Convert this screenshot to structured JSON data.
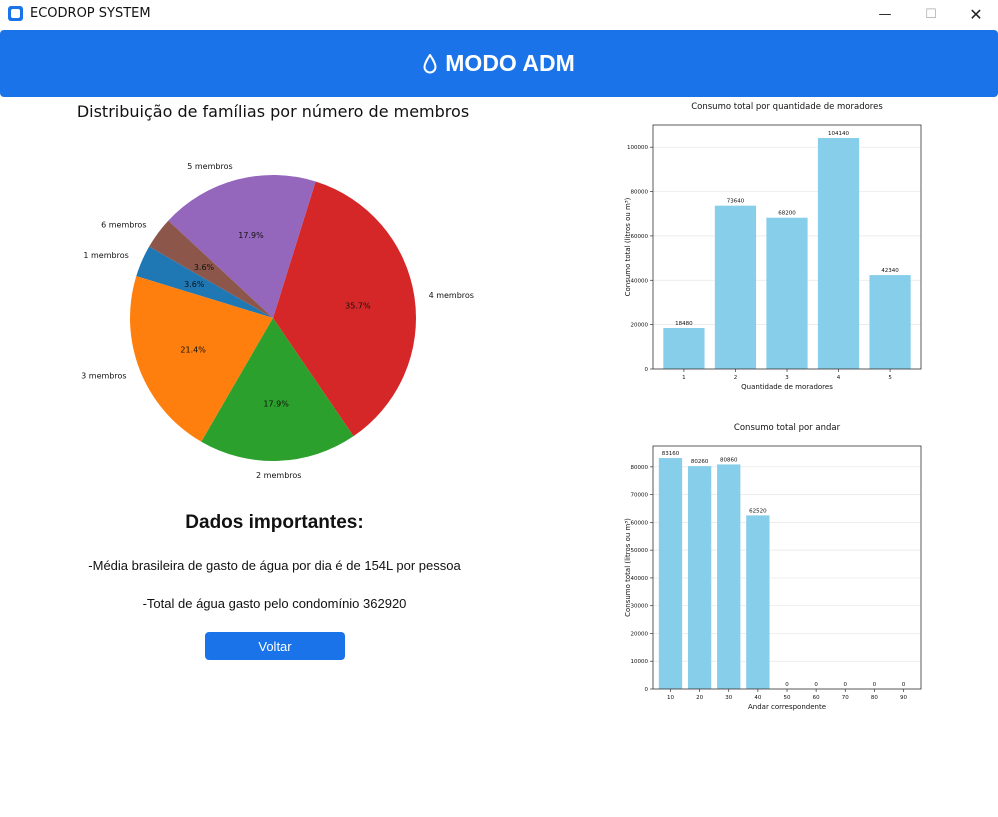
{
  "window": {
    "title": "ECODROP SYSTEM",
    "minimize": "—",
    "maximize": "☐",
    "close": "✕"
  },
  "header": {
    "title": "MODO ADM",
    "icon": "water-drop-icon",
    "color": "#1a73e8"
  },
  "important": {
    "title": "Dados importantes:",
    "line1": "-Média brasileira de gasto de água por dia é de 154L por pessoa",
    "line2": "-Total de água gasto pelo condomínio 362920",
    "back_label": "Voltar"
  },
  "chart_data": [
    {
      "type": "pie",
      "title": "Distribuição de famílias por número de membros",
      "slices": [
        {
          "label": "1 membros",
          "value": 3.6,
          "pct_label": "3.6%",
          "color": "#1f77b4"
        },
        {
          "label": "3 membros",
          "value": 21.4,
          "pct_label": "21.4%",
          "color": "#ff7f0e"
        },
        {
          "label": "2 membros",
          "value": 17.9,
          "pct_label": "17.9%",
          "color": "#2ca02c"
        },
        {
          "label": "4 membros",
          "value": 35.7,
          "pct_label": "35.7%",
          "color": "#d62728"
        },
        {
          "label": "5 membros",
          "value": 17.9,
          "pct_label": "17.9%",
          "color": "#9467bd"
        },
        {
          "label": "6 membros",
          "value": 3.6,
          "pct_label": "3.6%",
          "color": "#8c564b"
        }
      ],
      "start_angle_deg": 150
    },
    {
      "type": "bar",
      "title": "Consumo total por quantidade de moradores",
      "xlabel": "Quantidade de moradores",
      "ylabel": "Consumo total (litros ou m³)",
      "categories": [
        "1",
        "2",
        "3",
        "4",
        "5"
      ],
      "values": [
        18480,
        73640,
        68200,
        104140,
        42340
      ],
      "ylim": [
        0,
        110000
      ],
      "yticks": [
        0,
        20000,
        40000,
        60000,
        80000,
        100000
      ],
      "color": "#87ceeb",
      "grid": true
    },
    {
      "type": "bar",
      "title": "Consumo total por andar",
      "xlabel": "Andar correspondente",
      "ylabel": "Consumo total (litros ou m³)",
      "categories": [
        "10",
        "20",
        "30",
        "40",
        "50",
        "60",
        "70",
        "80",
        "90"
      ],
      "values": [
        83160,
        80260,
        80860,
        62520,
        0,
        0,
        0,
        0,
        0
      ],
      "ylim": [
        0,
        87500
      ],
      "yticks": [
        0,
        10000,
        20000,
        30000,
        40000,
        50000,
        60000,
        70000,
        80000
      ],
      "color": "#87ceeb",
      "grid": true
    }
  ]
}
